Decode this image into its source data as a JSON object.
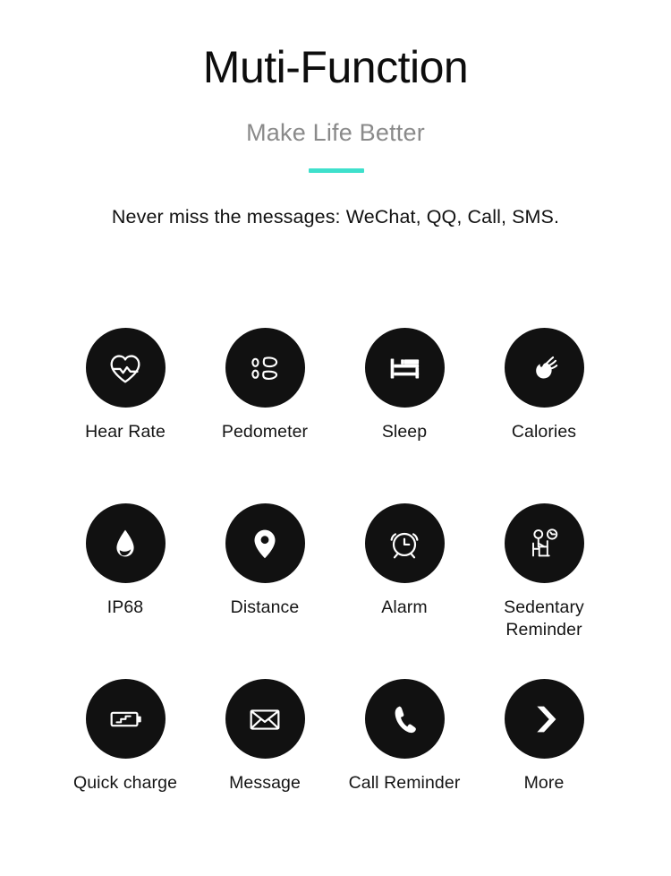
{
  "header": {
    "title": "Muti-Function",
    "subtitle": "Make Life Better",
    "tagline": "Never miss the messages: WeChat, QQ, Call, SMS.",
    "divider_color": "#3ee0cc",
    "title_color": "#0d0d0d",
    "subtitle_color": "#8a8a8a"
  },
  "theme": {
    "background": "#ffffff",
    "icon_circle_color": "#111111",
    "icon_glyph_color": "#ffffff",
    "accent": "#3ee0cc"
  },
  "features": {
    "rows": [
      {
        "cells": [
          {
            "label": "Hear Rate",
            "icon": "heart-rate-icon"
          },
          {
            "label": "Pedometer",
            "icon": "footprints-icon"
          },
          {
            "label": "Sleep",
            "icon": "bed-icon"
          },
          {
            "label": "Calories",
            "icon": "flame-icon"
          }
        ]
      },
      {
        "cells": [
          {
            "label": "IP68",
            "icon": "water-drop-icon"
          },
          {
            "label": "Distance",
            "icon": "map-pin-icon"
          },
          {
            "label": "Alarm",
            "icon": "alarm-clock-icon"
          },
          {
            "label": "Sedentary\nReminder",
            "icon": "sitting-person-clock-icon"
          }
        ]
      },
      {
        "cells": [
          {
            "label": "Quick charge",
            "icon": "battery-bolt-icon"
          },
          {
            "label": "Message",
            "icon": "envelope-icon"
          },
          {
            "label": "Call Reminder",
            "icon": "phone-handset-icon"
          },
          {
            "label": "More",
            "icon": "chevron-right-icon"
          }
        ]
      }
    ]
  }
}
